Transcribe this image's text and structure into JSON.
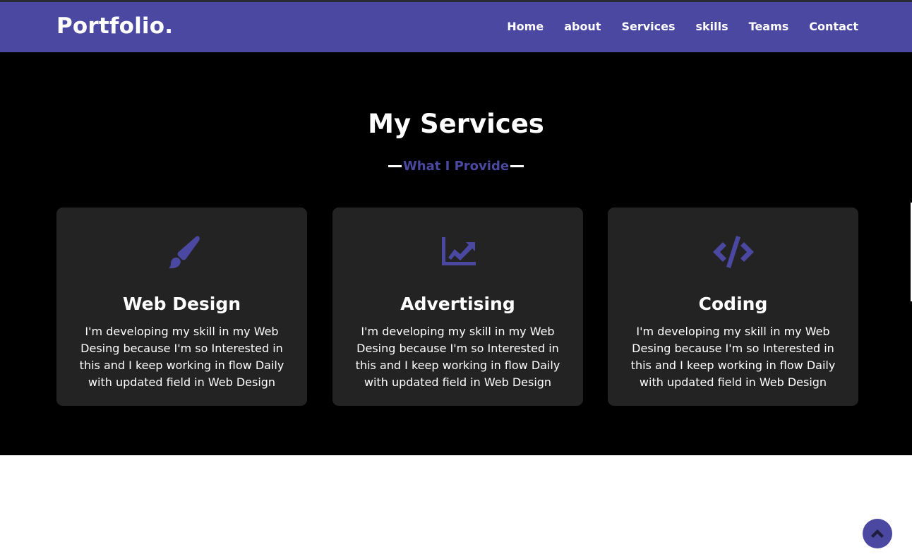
{
  "header": {
    "logo": "Portfolio.",
    "nav": [
      "Home",
      "about",
      "Services",
      "skills",
      "Teams",
      "Contact"
    ]
  },
  "services": {
    "title": "My Services",
    "subtitle": "What I Provide",
    "cards": [
      {
        "icon": "paint-brush-icon",
        "title": "Web Design",
        "description": "I'm developing my skill in my Web Desing because I'm so Interested in this and I keep working in flow Daily with updated field in Web Design"
      },
      {
        "icon": "chart-line-icon",
        "title": "Advertising",
        "description": "I'm developing my skill in my Web Desing because I'm so Interested in this and I keep working in flow Daily with updated field in Web Design"
      },
      {
        "icon": "code-icon",
        "title": "Coding",
        "description": "I'm developing my skill in my Web Desing because I'm so Interested in this and I keep working in flow Daily with updated field in Web Design"
      }
    ]
  },
  "scroll_top": {
    "icon": "chevron-up-icon"
  },
  "colors": {
    "accent": "#4a48a0",
    "background": "#000000",
    "card": "#232323"
  }
}
